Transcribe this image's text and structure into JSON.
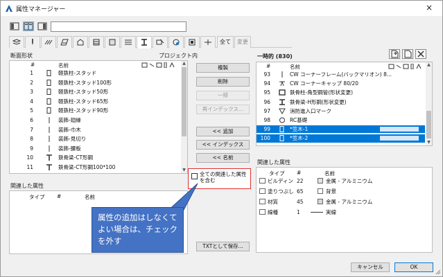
{
  "window": {
    "title": "属性マネージャー",
    "close_glyph": "×"
  },
  "tabs": {
    "all": "全て",
    "changes": "変更"
  },
  "left": {
    "header": "断面形状",
    "header_right": "プロジェクト内",
    "columns": {
      "num": "#",
      "name": "名前"
    },
    "rows": [
      {
        "num": "1",
        "name": "軽鉄柱-スタッド",
        "icon": "rect"
      },
      {
        "num": "2",
        "name": "軽鉄柱-スタッド100形",
        "icon": "rect"
      },
      {
        "num": "3",
        "name": "軽鉄柱-スタッド50形",
        "icon": "rect"
      },
      {
        "num": "4",
        "name": "軽鉄柱-スタッド65形",
        "icon": "rect"
      },
      {
        "num": "5",
        "name": "軽鉄柱-スタッド90形",
        "icon": "rect"
      },
      {
        "num": "6",
        "name": "装飾-廻縁",
        "icon": "line"
      },
      {
        "num": "7",
        "name": "装飾-巾木",
        "icon": "line"
      },
      {
        "num": "8",
        "name": "装飾-見切り",
        "icon": "line"
      },
      {
        "num": "9",
        "name": "装飾-腰板",
        "icon": "line"
      },
      {
        "num": "10",
        "name": "鉄骨梁-CT形鋼",
        "icon": "tee"
      },
      {
        "num": "11",
        "name": "鉄骨梁-CT形鋼100*100",
        "icon": "tee"
      }
    ]
  },
  "left_related": {
    "header": "関連した属性",
    "columns": {
      "type": "タイプ",
      "num": "#",
      "name": "名前"
    }
  },
  "middle": {
    "buttons": {
      "duplicate": "複製",
      "delete": "削除",
      "unify": "一掃",
      "reindex": "再インデックス...",
      "add": "<< 追加",
      "index": "<< インデックス",
      "name": "<< 名前",
      "save_txt": "TXTとして保存..."
    },
    "include_related_label": "全ての関連した属性を含む"
  },
  "callout": {
    "text": "属性の追加はしなくてよい場合は、チェックを外す"
  },
  "right": {
    "header": "一時的 (830)",
    "columns": {
      "num": "#",
      "name": "名前"
    },
    "rows": [
      {
        "num": "93",
        "name": "CW コーナーフレーム(バックマリオン) 8...",
        "icon": "line",
        "selected": false
      },
      {
        "num": "94",
        "name": "CW コーナーキャップ 80/20",
        "icon": "cap",
        "selected": false
      },
      {
        "num": "95",
        "name": "鉄骨柱-角型鋼管(形状変更)",
        "icon": "box",
        "selected": false
      },
      {
        "num": "96",
        "name": "鉄骨梁-H形鋼(形状変更)",
        "icon": "ibeam",
        "selected": false
      },
      {
        "num": "97",
        "name": "消防進入口マーク",
        "icon": "tri",
        "selected": false
      },
      {
        "num": "98",
        "name": "RC基礎",
        "icon": "circle",
        "selected": false
      },
      {
        "num": "99",
        "name": "*笠木-1",
        "icon": "rect",
        "selected": true
      },
      {
        "num": "100",
        "name": "*笠木-2",
        "icon": "rect",
        "selected": true
      }
    ]
  },
  "right_related": {
    "header": "関連した属性",
    "columns": {
      "type": "タイプ",
      "num": "#",
      "name": "名前"
    },
    "rows": [
      {
        "type": "ビルディン",
        "num": "22",
        "name": "金属 - アルミニウム",
        "swatch": "#e8e2dc"
      },
      {
        "type": "塗りつぶし",
        "num": "65",
        "name": "背景",
        "swatch": "#ffffff"
      },
      {
        "type": "材質",
        "num": "45",
        "name": "金属 - アルミニウム",
        "swatch": "#dcd6d0"
      },
      {
        "type": "線種",
        "num": "1",
        "name": "実線",
        "swatch": ""
      }
    ]
  },
  "footer": {
    "cancel": "キャンセル",
    "ok": "OK"
  },
  "colors": {
    "selection": "#0078d7",
    "callout": "#4472c4",
    "highlight_border": "#e03030"
  }
}
